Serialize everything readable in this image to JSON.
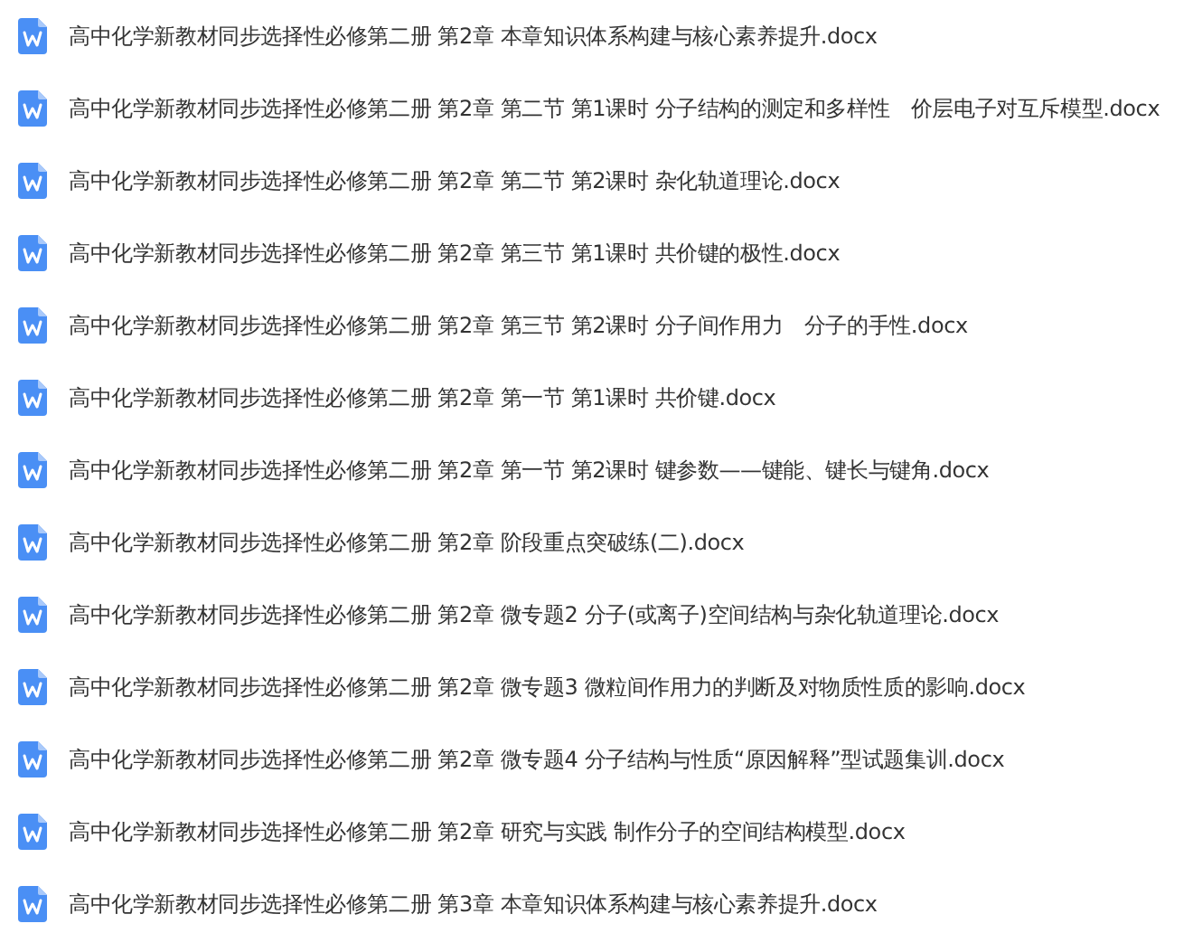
{
  "files": [
    {
      "name": "高中化学新教材同步选择性必修第二册 第2章 本章知识体系构建与核心素养提升.docx"
    },
    {
      "name": "高中化学新教材同步选择性必修第二册 第2章 第二节 第1课时 分子结构的测定和多样性　价层电子对互斥模型.docx"
    },
    {
      "name": "高中化学新教材同步选择性必修第二册 第2章 第二节 第2课时 杂化轨道理论.docx"
    },
    {
      "name": "高中化学新教材同步选择性必修第二册 第2章 第三节 第1课时 共价键的极性.docx"
    },
    {
      "name": "高中化学新教材同步选择性必修第二册 第2章 第三节 第2课时 分子间作用力　分子的手性.docx"
    },
    {
      "name": "高中化学新教材同步选择性必修第二册 第2章 第一节 第1课时 共价键.docx"
    },
    {
      "name": "高中化学新教材同步选择性必修第二册 第2章 第一节 第2课时 键参数——键能、键长与键角.docx"
    },
    {
      "name": "高中化学新教材同步选择性必修第二册 第2章 阶段重点突破练(二).docx"
    },
    {
      "name": "高中化学新教材同步选择性必修第二册 第2章 微专题2 分子(或离子)空间结构与杂化轨道理论.docx"
    },
    {
      "name": "高中化学新教材同步选择性必修第二册 第2章 微专题3 微粒间作用力的判断及对物质性质的影响.docx"
    },
    {
      "name": "高中化学新教材同步选择性必修第二册 第2章 微专题4 分子结构与性质“原因解释”型试题集训.docx"
    },
    {
      "name": "高中化学新教材同步选择性必修第二册 第2章 研究与实践 制作分子的空间结构模型.docx"
    },
    {
      "name": "高中化学新教材同步选择性必修第二册 第3章 本章知识体系构建与核心素养提升.docx"
    }
  ]
}
